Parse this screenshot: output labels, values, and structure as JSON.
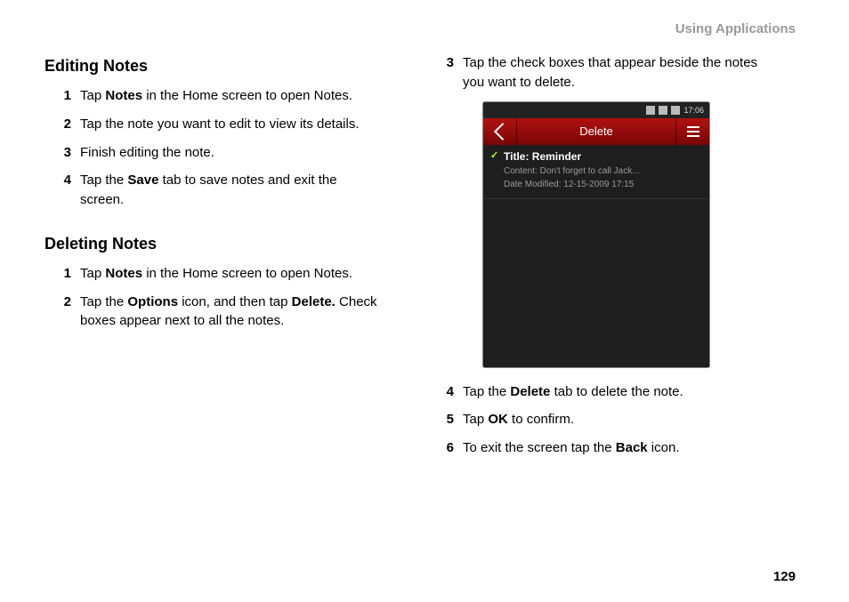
{
  "header": {
    "label": "Using Applications"
  },
  "page_number": "129",
  "left": {
    "heading1": "Editing Notes",
    "steps1": [
      {
        "n": "1",
        "pre": "Tap ",
        "bold": "Notes",
        "post": " in the Home screen to open Notes."
      },
      {
        "n": "2",
        "pre": "Tap the note you want to edit to view its details.",
        "bold": "",
        "post": ""
      },
      {
        "n": "3",
        "pre": "Finish editing the note.",
        "bold": "",
        "post": ""
      },
      {
        "n": "4",
        "pre": "Tap the ",
        "bold": "Save",
        "post": " tab to save notes and exit the screen."
      }
    ],
    "heading2": "Deleting Notes",
    "steps2": [
      {
        "n": "1",
        "pre": "Tap ",
        "bold": "Notes",
        "post": " in the Home screen to open Notes."
      },
      {
        "n": "2",
        "pre": "Tap the ",
        "bold": "Options",
        "mid": " icon, and then tap ",
        "bold2": "Delete.",
        "post": " Check boxes appear next to all the notes."
      }
    ]
  },
  "right": {
    "step3": {
      "n": "3",
      "text": "Tap the check boxes that appear beside the notes you want to delete."
    },
    "phone": {
      "time": "17:06",
      "appbar_title": "Delete",
      "note_title_label": "Title:",
      "note_title_value": "Reminder",
      "note_content_label": "Content:",
      "note_content_value": "Don't forget to call Jack...",
      "note_date_label": "Date Modified:",
      "note_date_value": "12-15-2009 17:15"
    },
    "steps_after": [
      {
        "n": "4",
        "pre": "Tap the ",
        "bold": "Delete",
        "post": " tab to delete the note."
      },
      {
        "n": "5",
        "pre": "Tap ",
        "bold": "OK",
        "post": " to confirm."
      },
      {
        "n": "6",
        "pre": "To exit the screen tap the ",
        "bold": "Back",
        "post": " icon."
      }
    ]
  }
}
